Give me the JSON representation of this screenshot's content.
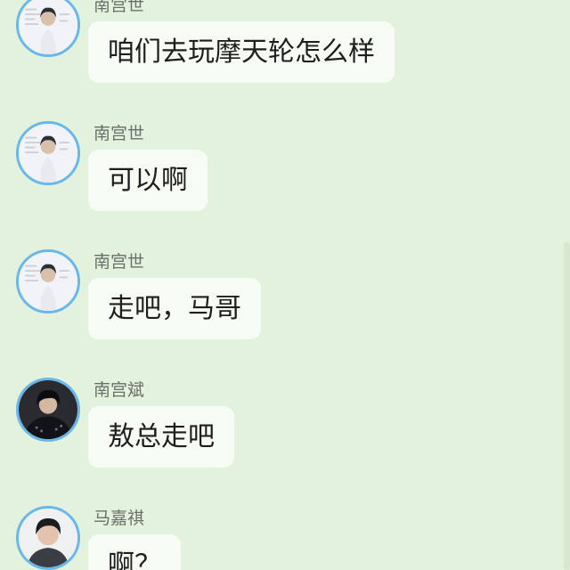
{
  "messages": [
    {
      "sender": "南宫世",
      "text": "咱们去玩摩天轮怎么样",
      "avatar": "light"
    },
    {
      "sender": "南宫世",
      "text": "可以啊",
      "avatar": "light"
    },
    {
      "sender": "南宫世",
      "text": "走吧，马哥",
      "avatar": "light"
    },
    {
      "sender": "南宫斌",
      "text": "敖总走吧",
      "avatar": "dark"
    },
    {
      "sender": "马嘉祺",
      "text": "啊？",
      "avatar": "portrait"
    }
  ],
  "colors": {
    "background": "#e3f2dc",
    "bubble": "#f6fbf3",
    "avatar_ring": "#6ab7ea",
    "name_text": "#6b6f6b"
  }
}
